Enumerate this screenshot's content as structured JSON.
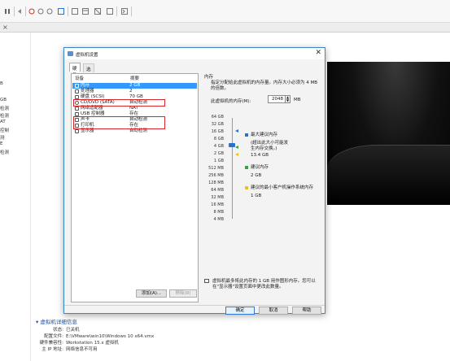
{
  "left_panel": {
    "items": [
      "B",
      "",
      "GB",
      "检测",
      "检测",
      "AT",
      "控制",
      "测",
      "E",
      "检测"
    ]
  },
  "details": {
    "title": "▾ 虚拟机详细信息",
    "rows": [
      {
        "key": "状态:",
        "value": "已关机"
      },
      {
        "key": "配置文件:",
        "value": "E:\\VMware\\win10\\Windows 10 x64.vmx"
      },
      {
        "key": "硬件兼容性:",
        "value": "Workstation 15.x 虚拟机"
      },
      {
        "key": "主 IP 地址:",
        "value": "网络信息不可用"
      }
    ]
  },
  "dialog": {
    "title": "虚拟机设置",
    "close": "✕",
    "tabs": [
      "硬件",
      "选项"
    ],
    "columns": [
      "设备",
      "摘要"
    ],
    "devices": [
      {
        "name": "内存",
        "summary": "2 GB",
        "selected": true,
        "icon": "memory-icon"
      },
      {
        "name": "处理器",
        "summary": "2",
        "icon": "cpu-icon"
      },
      {
        "name": "硬盘 (SCSI)",
        "summary": "70 GB",
        "icon": "disk-icon"
      },
      {
        "name": "CD/DVD (SATA)",
        "summary": "自动检测",
        "icon": "cd-icon"
      },
      {
        "name": "网络适配器",
        "summary": "NAT",
        "icon": "network-icon"
      },
      {
        "name": "USB 控制器",
        "summary": "存在",
        "icon": "usb-icon"
      },
      {
        "name": "声卡",
        "summary": "自动检测",
        "icon": "sound-icon"
      },
      {
        "name": "打印机",
        "summary": "存在",
        "icon": "printer-icon"
      },
      {
        "name": "显示器",
        "summary": "自动检测",
        "icon": "display-icon"
      }
    ],
    "add_button": "添加(A)...",
    "remove_button": "移除(R)",
    "memory": {
      "group_title": "内存",
      "description": "指定分配给此虚拟机的内存量。内存大小必须为 4 MB 的倍数。",
      "label": "此虚拟机的内存(M):",
      "value": "2048",
      "unit": "MB",
      "scale": [
        "64 GB",
        "32 GB",
        "16 GB",
        "8 GB",
        "4 GB",
        "2 GB",
        "1 GB",
        "512 MB",
        "256 MB",
        "128 MB",
        "64 MB",
        "32 MB",
        "16 MB",
        "8 MB",
        "4 MB"
      ],
      "max_recommended_label": "最大建议内存",
      "max_recommended_note": "(超出此大小可能发生内存交换。)",
      "max_recommended_value": "13.4 GB",
      "recommended_label": "建议内存",
      "recommended_value": "2 GB",
      "min_guest_label": "建议的最小客户机操作系统内存",
      "min_guest_value": "1 GB",
      "warning": "虚拟机最多将此内存的 1 GB 用作图形内存。您可以在\"显示器\"设置页面中更改此数量。"
    },
    "ok_button": "确定",
    "cancel_button": "取消",
    "help_button": "帮助"
  },
  "colors": {
    "accent": "#3399ff",
    "highlight": "#d9262b",
    "max_marker": "#2a72c8",
    "recommended_marker": "#3aa335",
    "min_marker": "#e8c21a"
  }
}
